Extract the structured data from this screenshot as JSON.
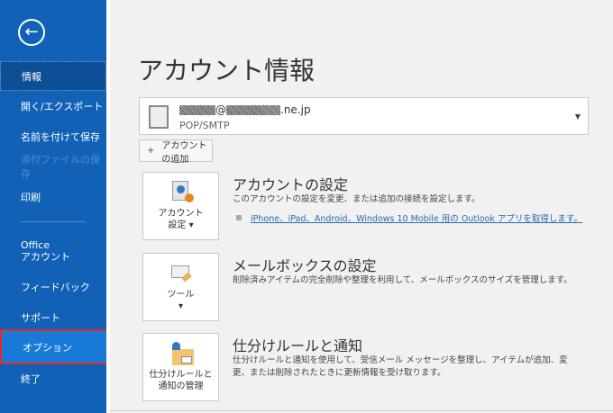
{
  "sidebar": {
    "back_icon": "back-arrow-circle-icon",
    "items": [
      {
        "label": "情報",
        "state": "selected"
      },
      {
        "label": "開く/エクスポート"
      },
      {
        "label": "名前を付けて保存"
      },
      {
        "label": "添付ファイルの保存",
        "state": "disabled"
      },
      {
        "label": "印刷"
      },
      {
        "label": "Office\nアカウント"
      },
      {
        "label": "フィードバック"
      },
      {
        "label": "サポート"
      },
      {
        "label": "オプション",
        "state": "highlighted"
      },
      {
        "label": "終了"
      }
    ]
  },
  "main": {
    "title": "アカウント情報",
    "account": {
      "email_at": "@",
      "email_domain": ".ne.jp",
      "type": "POP/SMTP"
    },
    "add_account": "アカウントの追加",
    "sections": [
      {
        "tile_label": "アカウント\n設定 ▾",
        "heading": "アカウントの設定",
        "description": "このアカウントの設定を変更、または追加の接続を設定します。",
        "link": "iPhone、iPad、Android、Windows 10 Mobile 用の Outlook アプリを取得します。"
      },
      {
        "tile_label": "ツール\n▾",
        "heading": "メールボックスの設定",
        "description": "削除済みアイテムの完全削除や整理を利用して、メールボックスのサイズを管理します。"
      },
      {
        "tile_label": "仕分けルールと\n通知の管理",
        "heading": "仕分けルールと通知",
        "description": "仕分けルールと通知を使用して、受信メール メッセージを整理し、アイテムが追加、変更、または削除されたときに更新情報を受け取ります。"
      }
    ]
  },
  "colors": {
    "sidebar": "#1162b7",
    "selected": "#0c4f97",
    "highlight": "#1a7ad8",
    "highlight_border": "#e8262a",
    "link": "#2a6aa8"
  }
}
